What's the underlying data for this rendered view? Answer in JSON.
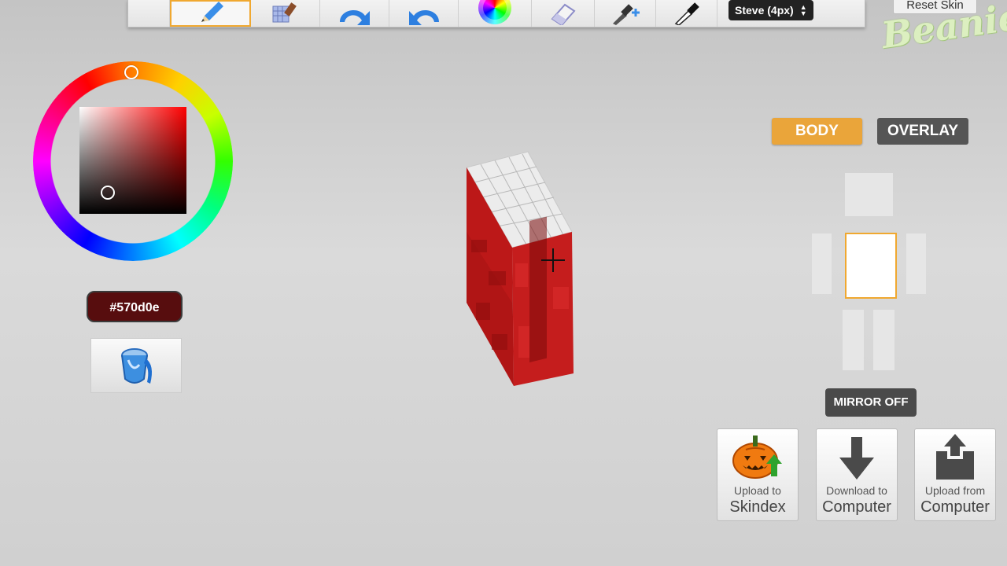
{
  "toolbar": {
    "tools": [
      {
        "name": "pencil",
        "active": true
      },
      {
        "name": "pixel-brush",
        "active": false
      },
      {
        "name": "undo",
        "active": false
      },
      {
        "name": "redo",
        "active": false
      },
      {
        "name": "color-picker-wheel",
        "active": false
      },
      {
        "name": "eraser",
        "active": false
      },
      {
        "name": "eyedropper-plus",
        "active": false
      },
      {
        "name": "eyedropper",
        "active": false
      }
    ],
    "brush_size": "Steve (4px)",
    "reset_label": "Reset Skin"
  },
  "logo_text": "Beanie",
  "color": {
    "hex": "#570d0e",
    "hue_color": "#ff0000"
  },
  "layers": {
    "body_label": "BODY",
    "overlay_label": "OVERLAY",
    "active": "body"
  },
  "body_parts": {
    "active": "torso"
  },
  "mirror_label": "MIRROR OFF",
  "actions": {
    "upload_skindex": {
      "line1": "Upload to",
      "line2": "Skindex"
    },
    "download": {
      "line1": "Download to",
      "line2": "Computer"
    },
    "upload_from": {
      "line1": "Upload from",
      "line2": "Computer"
    }
  },
  "accent_color": "#eaa53a"
}
